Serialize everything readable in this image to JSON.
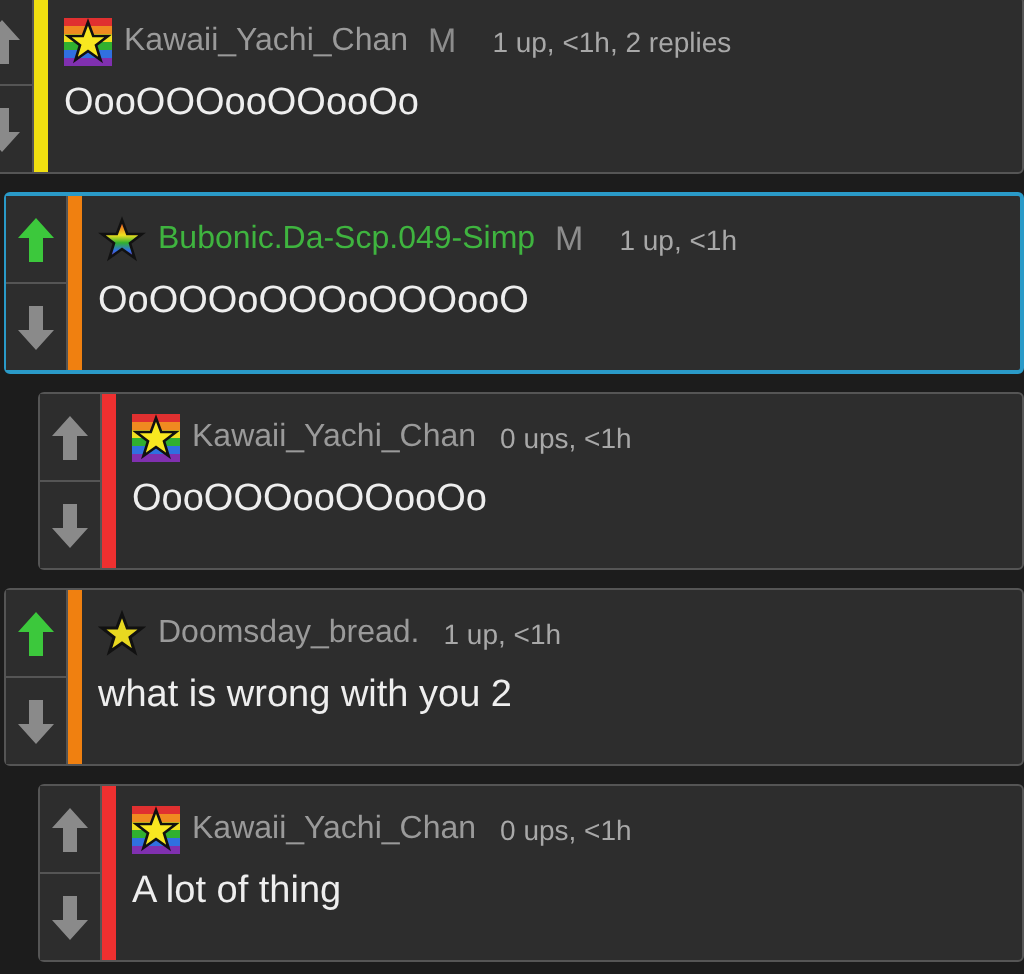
{
  "comments": [
    {
      "avatar": {
        "kind": "flag"
      },
      "user": {
        "name": "Kawaii_Yachi_Chan",
        "color": "#9a9a9a"
      },
      "badge": "M",
      "meta": "1 up, <1h, 2 replies",
      "text": "OooOOOooOOooOo",
      "upvoted": false,
      "color": "#f0e010",
      "highlighted": false,
      "children": [
        {
          "avatar": {
            "kind": "rainbow-star"
          },
          "user": {
            "name": "Bubonic.Da-Scp.049-Simp",
            "color": "#3fb43f"
          },
          "badge": "M",
          "meta": "1 up, <1h",
          "text": "OoOOOoOOOoOOOooO",
          "upvoted": true,
          "color": "#f08010",
          "highlighted": true,
          "children": [
            {
              "avatar": {
                "kind": "flag"
              },
              "user": {
                "name": "Kawaii_Yachi_Chan",
                "color": "#9a9a9a"
              },
              "meta": "0 ups, <1h",
              "text": "OooOOOooOOooOo",
              "upvoted": false,
              "color": "#ee3030",
              "highlighted": false
            }
          ]
        },
        {
          "avatar": {
            "kind": "star"
          },
          "user": {
            "name": "Doomsday_bread.",
            "color": "#9a9a9a"
          },
          "meta": "1 up, <1h",
          "text": "what is wrong with you 2",
          "upvoted": true,
          "color": "#f08010",
          "highlighted": false,
          "children": [
            {
              "avatar": {
                "kind": "flag"
              },
              "user": {
                "name": "Kawaii_Yachi_Chan",
                "color": "#9a9a9a"
              },
              "meta": "0 ups, <1h",
              "text": "A lot of thing",
              "upvoted": false,
              "color": "#ee3030",
              "highlighted": false
            }
          ]
        }
      ]
    }
  ]
}
